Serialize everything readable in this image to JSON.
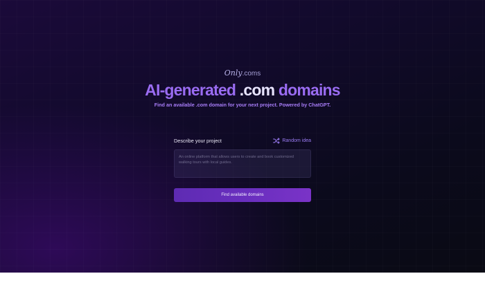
{
  "logo": {
    "script": "Only",
    "tld": ".coms"
  },
  "hero": {
    "title_part1": "AI-generated",
    "title_part2": ".com",
    "title_part3": "domains",
    "subtitle": "Find an available .com domain for your next project. Powered by ChatGPT."
  },
  "form": {
    "label": "Describe your project",
    "random_label": "Random idea",
    "textarea_placeholder": "An online platform that allows users to create and book customized walking tours with local guides.",
    "submit_label": "Find available domains"
  },
  "colors": {
    "accent": "#9a6cf2",
    "button": "#6a2fbf",
    "background": "#120a2c"
  },
  "icons": {
    "random": "shuffle-icon"
  }
}
